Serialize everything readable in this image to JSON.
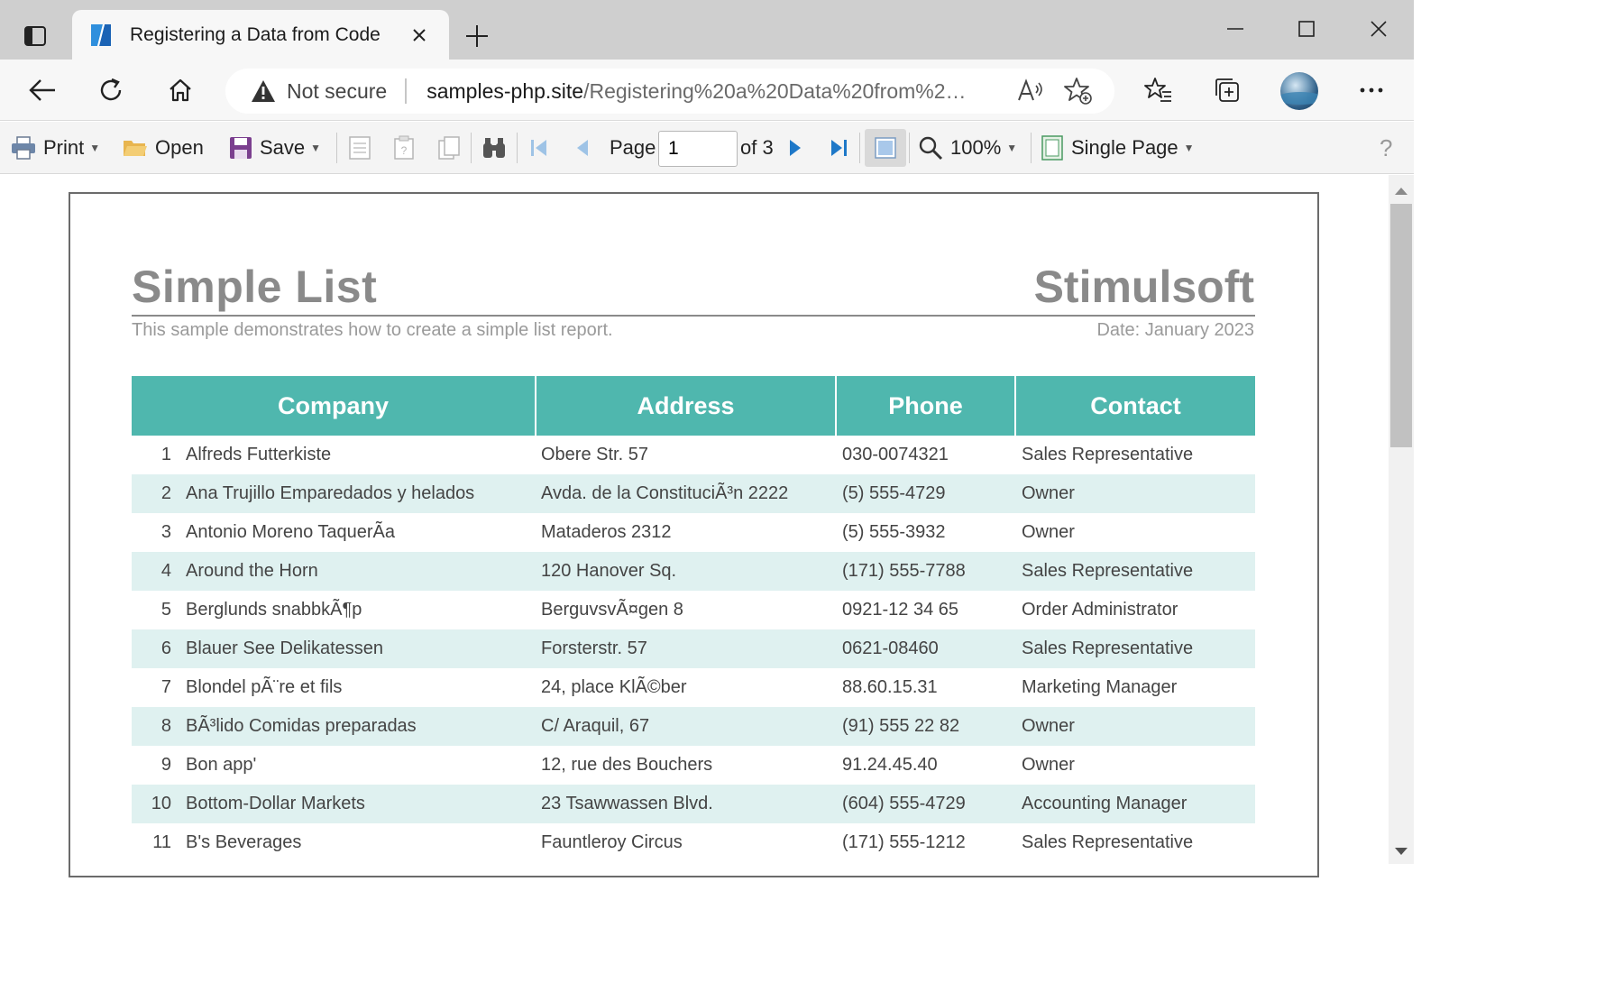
{
  "browser": {
    "tab_title": "Registering a Data from Code",
    "security_label": "Not secure",
    "url_host": "samples-php.site",
    "url_path": "/Registering%20a%20Data%20from%2…"
  },
  "viewer_toolbar": {
    "print_label": "Print",
    "open_label": "Open",
    "save_label": "Save",
    "page_label": "Page",
    "page_value": "1",
    "page_total": "of 3",
    "zoom_label": "100%",
    "view_mode_label": "Single Page",
    "help_label": "?"
  },
  "report": {
    "title": "Simple List",
    "brand": "Stimulsoft",
    "subtitle": "This sample demonstrates how to create a simple list report.",
    "date": "Date: January 2023",
    "columns": [
      "Company",
      "Address",
      "Phone",
      "Contact"
    ],
    "rows": [
      {
        "num": "1",
        "company": "Alfreds Futterkiste",
        "address": "Obere Str. 57",
        "phone": "030-0074321",
        "contact": "Sales Representative"
      },
      {
        "num": "2",
        "company": "Ana Trujillo Emparedados y helados",
        "address": "Avda. de la ConstituciÃ³n 2222",
        "phone": "(5) 555-4729",
        "contact": "Owner"
      },
      {
        "num": "3",
        "company": "Antonio Moreno TaquerÃa",
        "address": "Mataderos 2312",
        "phone": "(5) 555-3932",
        "contact": "Owner"
      },
      {
        "num": "4",
        "company": "Around the Horn",
        "address": "120 Hanover Sq.",
        "phone": "(171) 555-7788",
        "contact": "Sales Representative"
      },
      {
        "num": "5",
        "company": "Berglunds snabbkÃ¶p",
        "address": "BerguvsvÃ¤gen 8",
        "phone": "0921-12 34 65",
        "contact": "Order Administrator"
      },
      {
        "num": "6",
        "company": "Blauer See Delikatessen",
        "address": "Forsterstr. 57",
        "phone": "0621-08460",
        "contact": "Sales Representative"
      },
      {
        "num": "7",
        "company": "Blondel pÃ¨re et fils",
        "address": "24, place KlÃ©ber",
        "phone": "88.60.15.31",
        "contact": "Marketing Manager"
      },
      {
        "num": "8",
        "company": "BÃ³lido Comidas preparadas",
        "address": "C/ Araquil, 67",
        "phone": "(91) 555 22 82",
        "contact": "Owner"
      },
      {
        "num": "9",
        "company": "Bon app'",
        "address": "12, rue des Bouchers",
        "phone": "91.24.45.40",
        "contact": "Owner"
      },
      {
        "num": "10",
        "company": "Bottom-Dollar Markets",
        "address": "23 Tsawwassen Blvd.",
        "phone": "(604) 555-4729",
        "contact": "Accounting Manager"
      },
      {
        "num": "11",
        "company": "B's Beverages",
        "address": "Fauntleroy Circus",
        "phone": "(171) 555-1212",
        "contact": "Sales Representative"
      }
    ]
  },
  "colors": {
    "header_teal": "#4fb7ae",
    "alt_row": "#dff1f0"
  }
}
